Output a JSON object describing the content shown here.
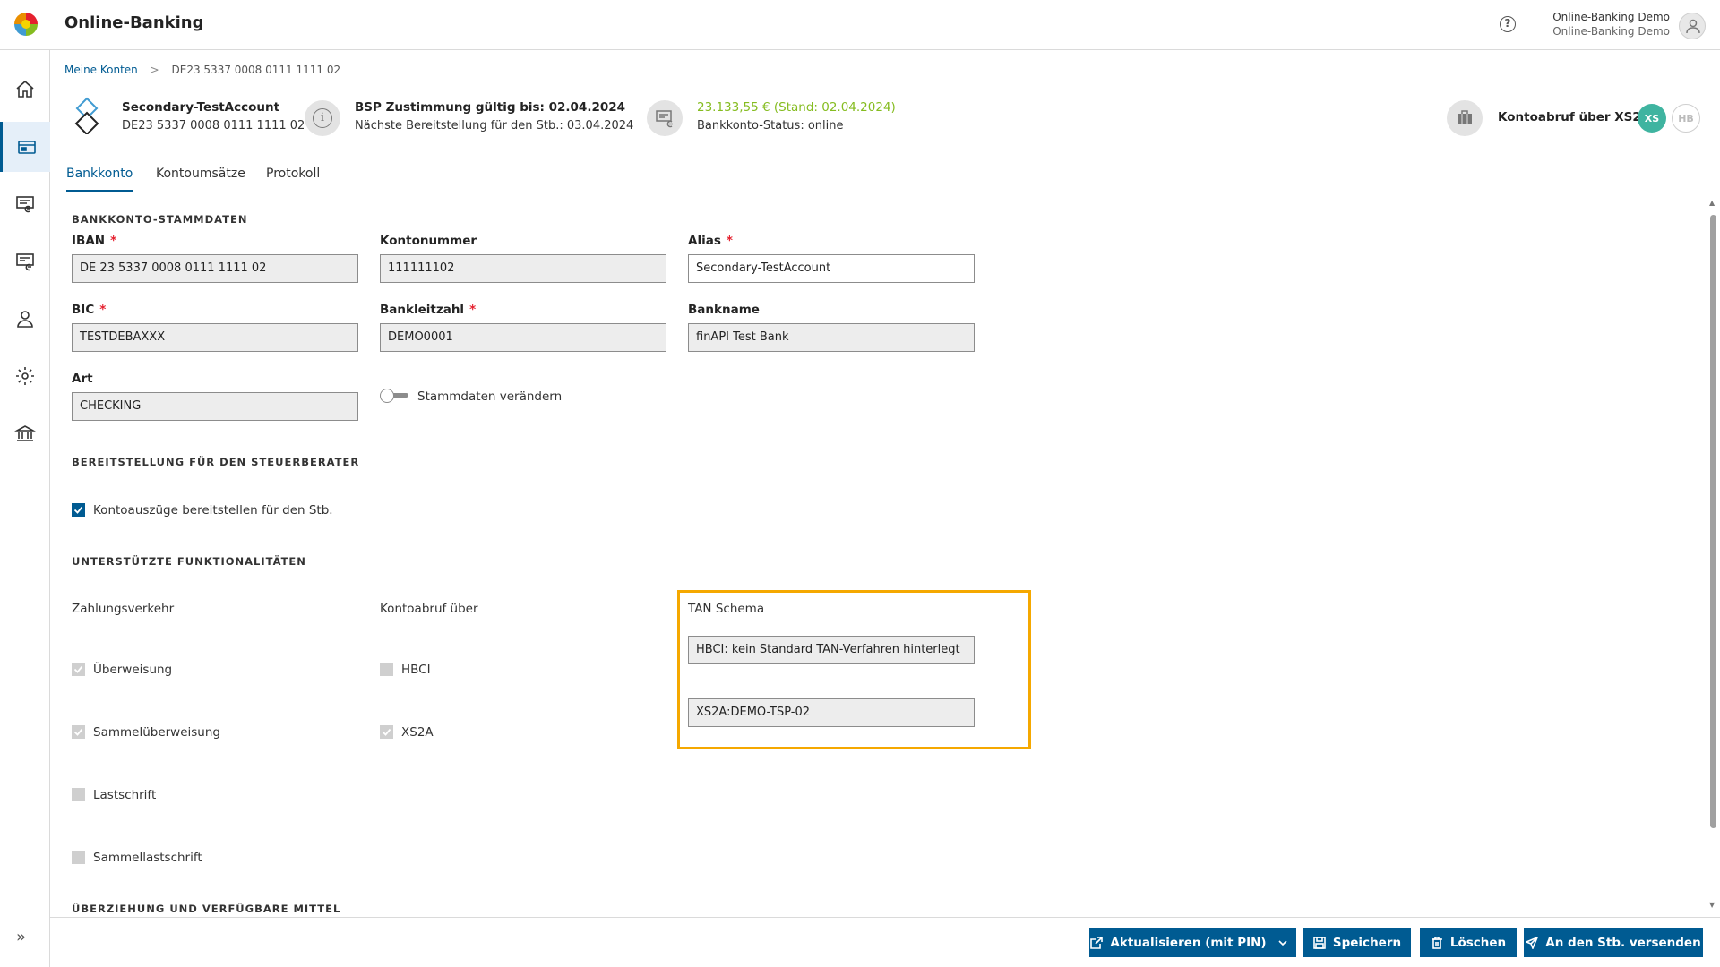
{
  "header": {
    "app_title": "Online-Banking",
    "user_line1": "Online-Banking Demo",
    "user_line2": "Online-Banking Demo",
    "help_glyph": "?"
  },
  "breadcrumb": {
    "root": "Meine Konten",
    "separator": ">",
    "current": "DE23 5337 0008 0111 1111 02"
  },
  "account": {
    "name": "Secondary-TestAccount",
    "iban": "DE23 5337 0008 0111 1111 02",
    "bsp_title": "BSP Zustimmung gültig bis: 02.04.2024",
    "bsp_next": "Nächste Bereitstellung für den Stb.: 03.04.2024",
    "balance": "23.133,55 € (Stand: 02.04.2024)",
    "status": "Bankkonto-Status: online",
    "kontoabruf": "Kontoabruf über XS2A",
    "badge_xs": "XS",
    "badge_hb": "HB",
    "info_glyph": "i",
    "colors": {
      "balance": "#85bc20",
      "badge_xs": "#3fb4a0",
      "primary": "#005b92",
      "highlight": "#f5a800"
    }
  },
  "tabs": [
    {
      "label": "Bankkonto",
      "active": true
    },
    {
      "label": "Kontoumsätze",
      "active": false
    },
    {
      "label": "Protokoll",
      "active": false
    }
  ],
  "stammdaten": {
    "section_title": "BANKKONTO-STAMMDATEN",
    "iban_label": "IBAN",
    "iban_value": "DE 23 5337 0008 0111 1111 02",
    "kontonummer_label": "Kontonummer",
    "kontonummer_value": "111111102",
    "alias_label": "Alias",
    "alias_value": "Secondary-TestAccount",
    "bic_label": "BIC",
    "bic_value": "TESTDEBAXXX",
    "blz_label": "Bankleitzahl",
    "blz_value": "DEMO0001",
    "bankname_label": "Bankname",
    "bankname_value": "finAPI Test Bank",
    "art_label": "Art",
    "art_value": "CHECKING",
    "toggle_label": "Stammdaten verändern",
    "required_mark": "*"
  },
  "bereitstellung": {
    "section_title": "BEREITSTELLUNG FÜR DEN STEUERBERATER",
    "checkbox_label": "Kontoauszüge bereitstellen für den Stb."
  },
  "funktionen": {
    "section_title": "UNTERSTÜTZTE FUNKTIONALITÄTEN",
    "zahlungsverkehr_label": "Zahlungsverkehr",
    "kontoabruf_label": "Kontoabruf über",
    "tan_label": "TAN Schema",
    "ueberweisung": "Überweisung",
    "sammelueberweisung": "Sammelüberweisung",
    "lastschrift": "Lastschrift",
    "sammellastschrift": "Sammellastschrift",
    "hbci": "HBCI",
    "xs2a": "XS2A",
    "tan_hbci_value": "HBCI: kein Standard TAN-Verfahren hinterlegt",
    "tan_xs2a_value": "XS2A:DEMO-TSP-02"
  },
  "ueberziehung": {
    "section_title": "ÜBERZIEHUNG UND VERFÜGBARE MITTEL"
  },
  "footer": {
    "aktualisieren": "Aktualisieren (mit PIN)",
    "speichern": "Speichern",
    "loeschen": "Löschen",
    "versenden": "An den Stb. versenden"
  }
}
